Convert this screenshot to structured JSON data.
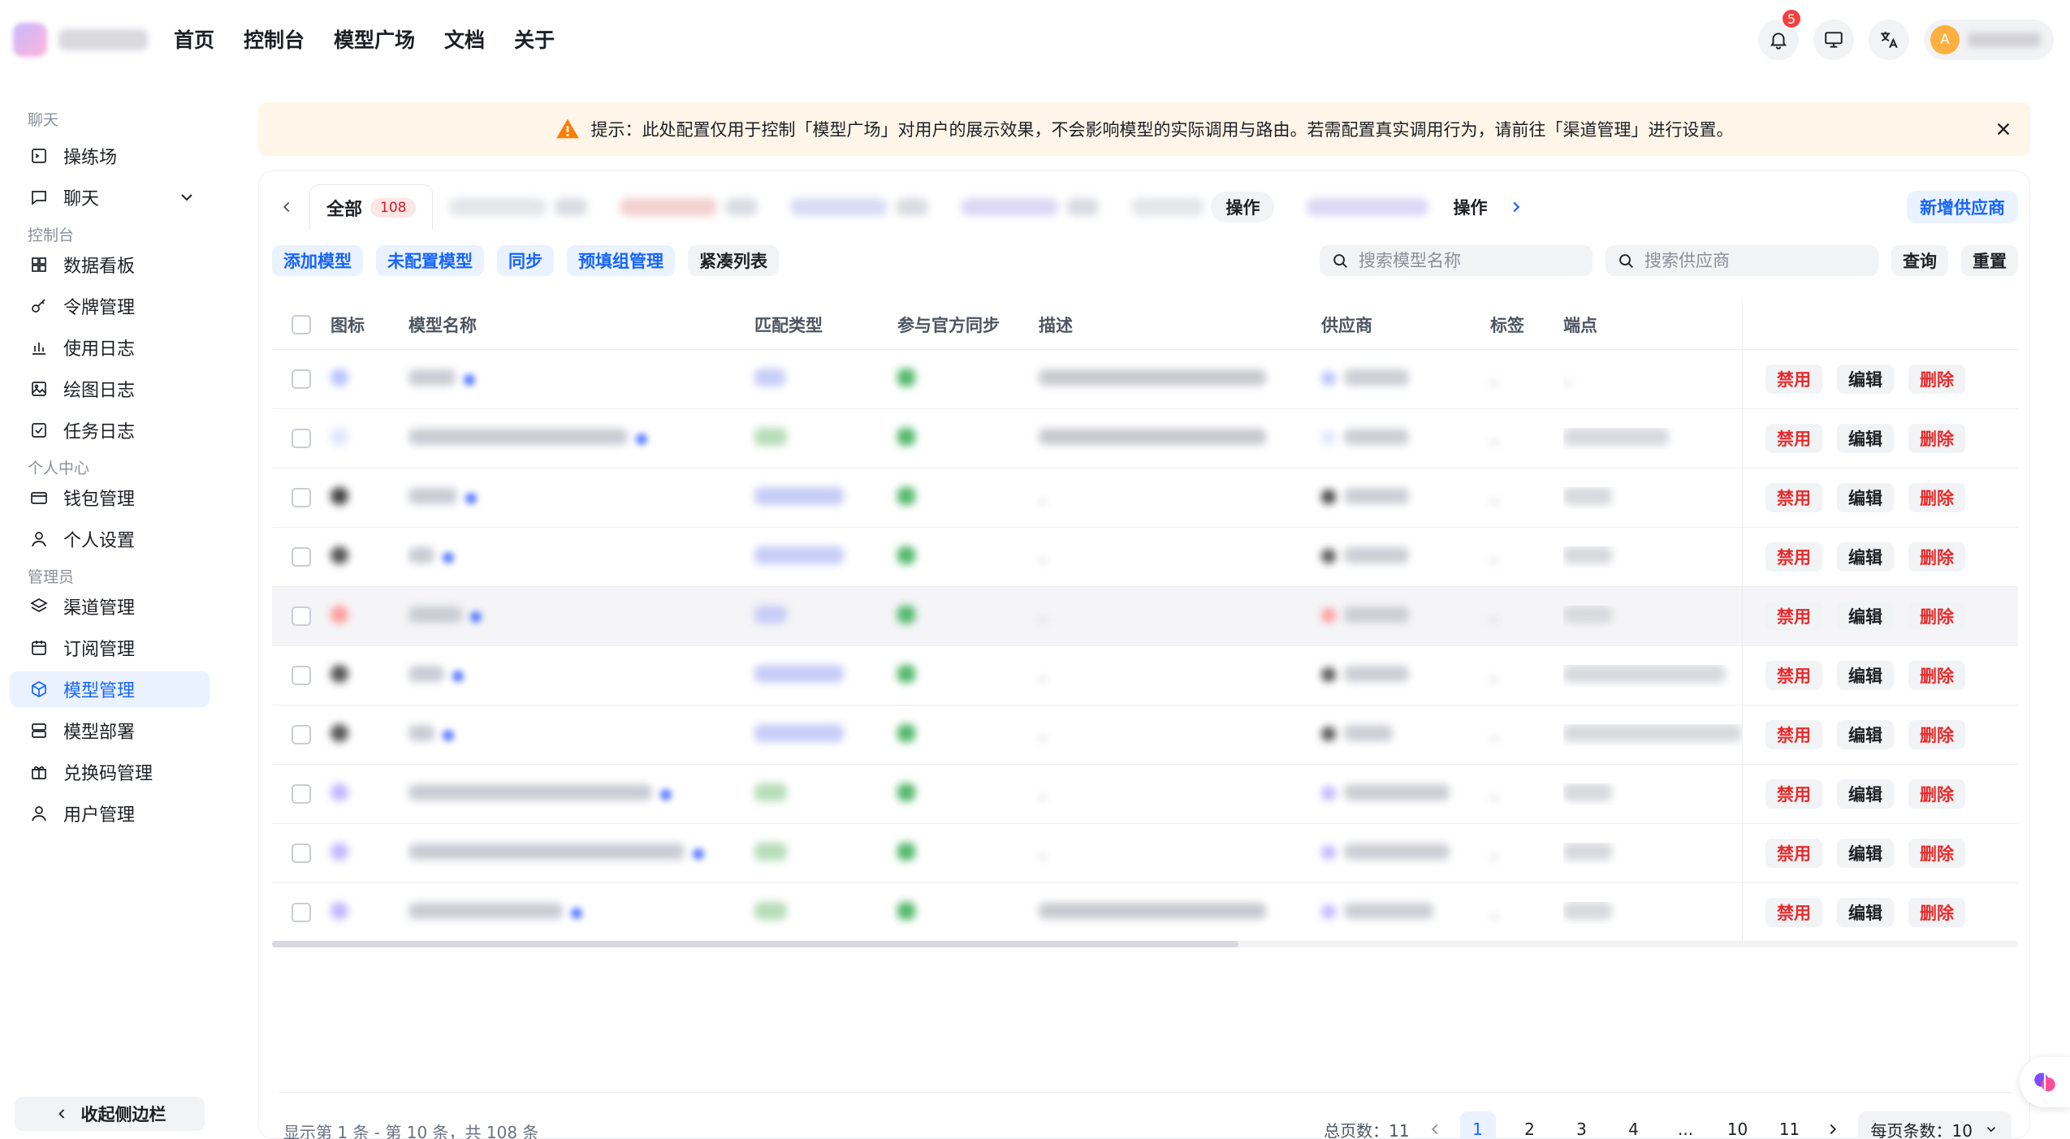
{
  "topnav": [
    "首页",
    "控制台",
    "模型广场",
    "文档",
    "关于"
  ],
  "notifications": {
    "count": "5"
  },
  "user": {
    "avatar_letter": "A"
  },
  "sidebar": {
    "groups": [
      {
        "label": "聊天",
        "items": [
          {
            "label": "操练场",
            "icon": "playground-icon"
          },
          {
            "label": "聊天",
            "icon": "chat-icon",
            "expandable": true
          }
        ]
      },
      {
        "label": "控制台",
        "items": [
          {
            "label": "数据看板",
            "icon": "dashboard-icon"
          },
          {
            "label": "令牌管理",
            "icon": "key-icon"
          },
          {
            "label": "使用日志",
            "icon": "bar-chart-icon"
          },
          {
            "label": "绘图日志",
            "icon": "image-icon"
          },
          {
            "label": "任务日志",
            "icon": "task-icon"
          }
        ]
      },
      {
        "label": "个人中心",
        "items": [
          {
            "label": "钱包管理",
            "icon": "wallet-icon"
          },
          {
            "label": "个人设置",
            "icon": "user-icon"
          }
        ]
      },
      {
        "label": "管理员",
        "items": [
          {
            "label": "渠道管理",
            "icon": "layers-icon"
          },
          {
            "label": "订阅管理",
            "icon": "calendar-icon"
          },
          {
            "label": "模型管理",
            "icon": "cube-icon",
            "active": true
          },
          {
            "label": "模型部署",
            "icon": "server-icon"
          },
          {
            "label": "兑换码管理",
            "icon": "gift-icon"
          },
          {
            "label": "用户管理",
            "icon": "user-icon"
          }
        ]
      }
    ],
    "collapse_label": "收起侧边栏"
  },
  "notice": {
    "text": "提示：此处配置仅用于控制「模型广场」对用户的展示效果，不会影响模型的实际调用与路由。若需配置真实调用行为，请前往「渠道管理」进行设置。"
  },
  "tabs": {
    "all_label": "全部",
    "all_count": "108",
    "op_label": "操作",
    "op_label_2": "操作",
    "add_vendor": "新增供应商"
  },
  "actions": {
    "add_model": "添加模型",
    "unconfigured": "未配置模型",
    "sync": "同步",
    "prefill": "预填组管理",
    "compact": "紧凑列表",
    "search_model_placeholder": "搜索模型名称",
    "search_vendor_placeholder": "搜索供应商",
    "query": "查询",
    "reset": "重置"
  },
  "table": {
    "headers": {
      "icon": "图标",
      "name": "模型名称",
      "match": "匹配类型",
      "sync": "参与官方同步",
      "desc": "描述",
      "vendor": "供应商",
      "tag": "标签",
      "endpoint": "端点"
    },
    "row_actions": {
      "disable": "禁用",
      "edit": "编辑",
      "delete": "删除"
    }
  },
  "footer": {
    "range_text": "显示第 1 条 - 第 10 条，共 108 条",
    "total_pages_label": "总页数：11",
    "pages": [
      "1",
      "2",
      "3",
      "4",
      "...",
      "10",
      "11"
    ],
    "current_page": "1",
    "per_page_label": "每页条数：10"
  }
}
